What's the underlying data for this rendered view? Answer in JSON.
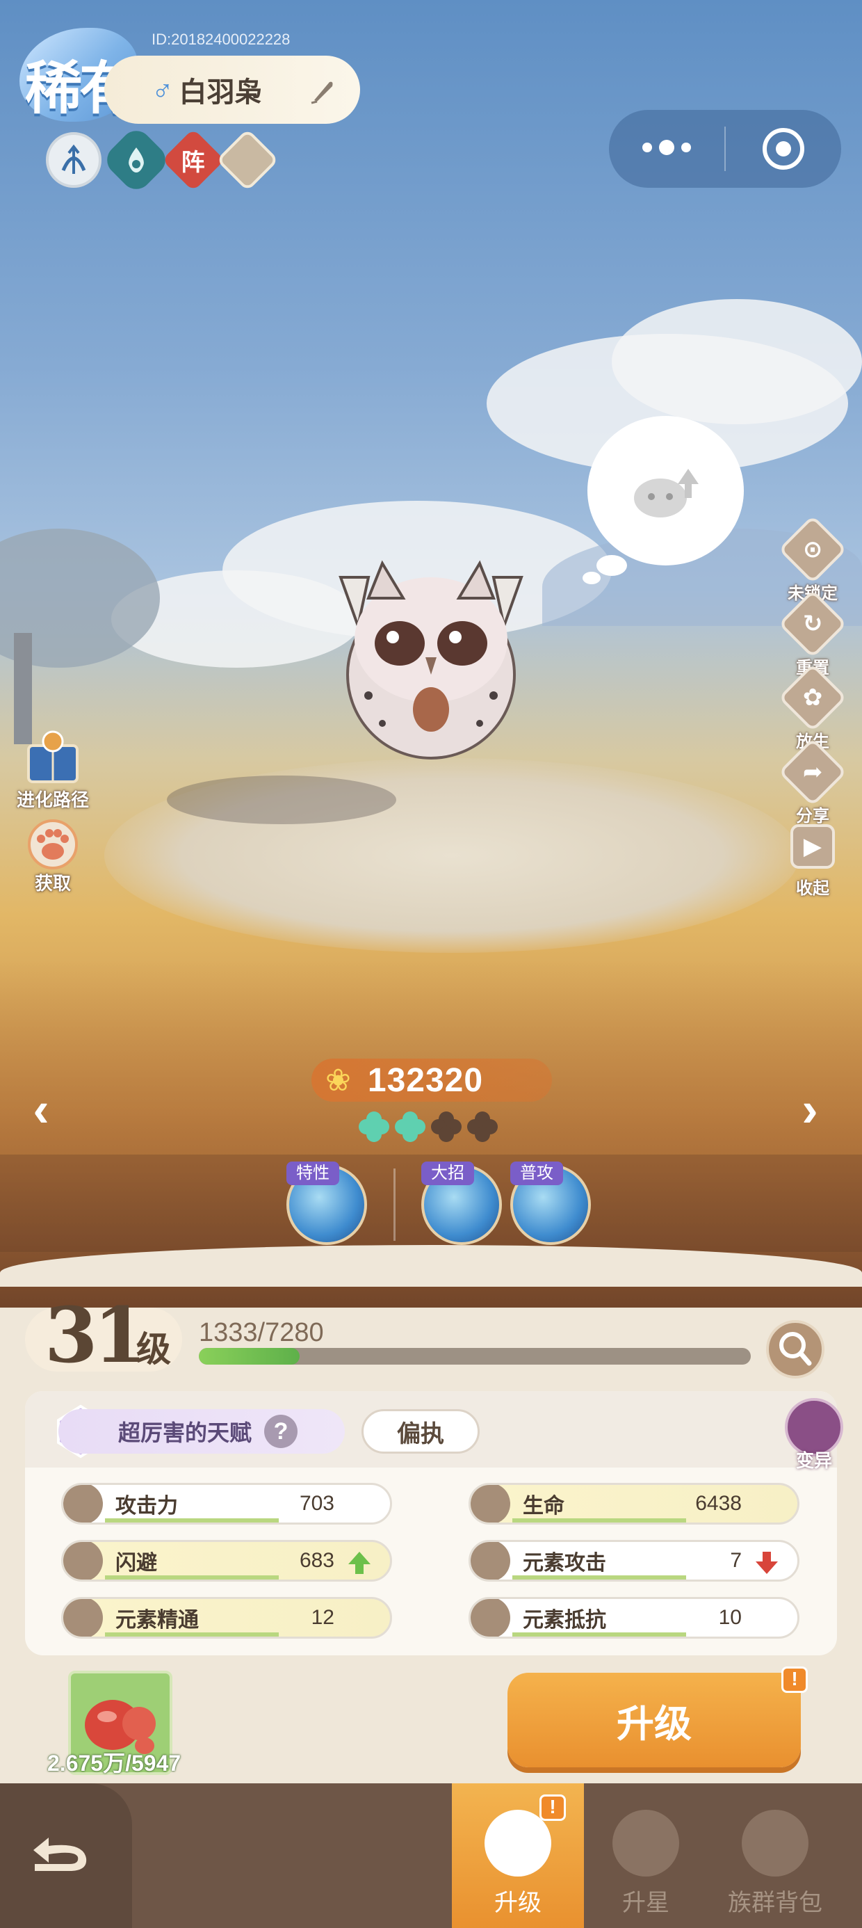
{
  "header": {
    "rarity": "稀有",
    "pet_id": "ID:20182400022228",
    "gender_symbol": "♂",
    "pet_name": "白羽枭",
    "formation_char": "阵"
  },
  "side_actions": [
    {
      "label": "未锁定",
      "icon": "unlock-icon"
    },
    {
      "label": "重置",
      "icon": "reset-icon"
    },
    {
      "label": "放生",
      "icon": "release-icon"
    },
    {
      "label": "分享",
      "icon": "share-icon"
    },
    {
      "label": "收起",
      "icon": "collapse-icon"
    }
  ],
  "left_actions": [
    {
      "label": "进化路径",
      "icon": "evolution-path-icon"
    },
    {
      "label": "获取",
      "icon": "obtain-icon"
    }
  ],
  "power": {
    "value": "132320"
  },
  "clovers": {
    "filled": 2,
    "total": 4
  },
  "skills": {
    "trait_tag": "特性",
    "ultimate_tag": "大招",
    "normal_tag": "普攻"
  },
  "level": {
    "number": "31",
    "unit": "级",
    "exp_text": "1333/7280",
    "exp_fraction": 0.183
  },
  "talent": {
    "label": "超厉害的天赋",
    "help": "?",
    "trait": "偏执",
    "mutate_label": "变异"
  },
  "stats": [
    {
      "name": "攻击力",
      "value": "703",
      "highlight": false,
      "trend": ""
    },
    {
      "name": "生命",
      "value": "6438",
      "highlight": true,
      "trend": ""
    },
    {
      "name": "闪避",
      "value": "683",
      "highlight": true,
      "trend": "up"
    },
    {
      "name": "元素攻击",
      "value": "7",
      "highlight": false,
      "trend": "down"
    },
    {
      "name": "元素精通",
      "value": "12",
      "highlight": true,
      "trend": ""
    },
    {
      "name": "元素抵抗",
      "value": "10",
      "highlight": false,
      "trend": ""
    }
  ],
  "resources": {
    "coin_text": "2.675万/5947"
  },
  "actions": {
    "upgrade_label": "升级",
    "alert_mark": "!"
  },
  "bottom_nav": [
    {
      "label": "升级",
      "active": true
    },
    {
      "label": "升星",
      "active": false
    },
    {
      "label": "族群背包",
      "active": false
    }
  ],
  "colors": {
    "accent": "#EE9A34",
    "exp_fill": "#6CBD4E",
    "up_arrow": "#6CC04A",
    "down_arrow": "#D8453A"
  }
}
